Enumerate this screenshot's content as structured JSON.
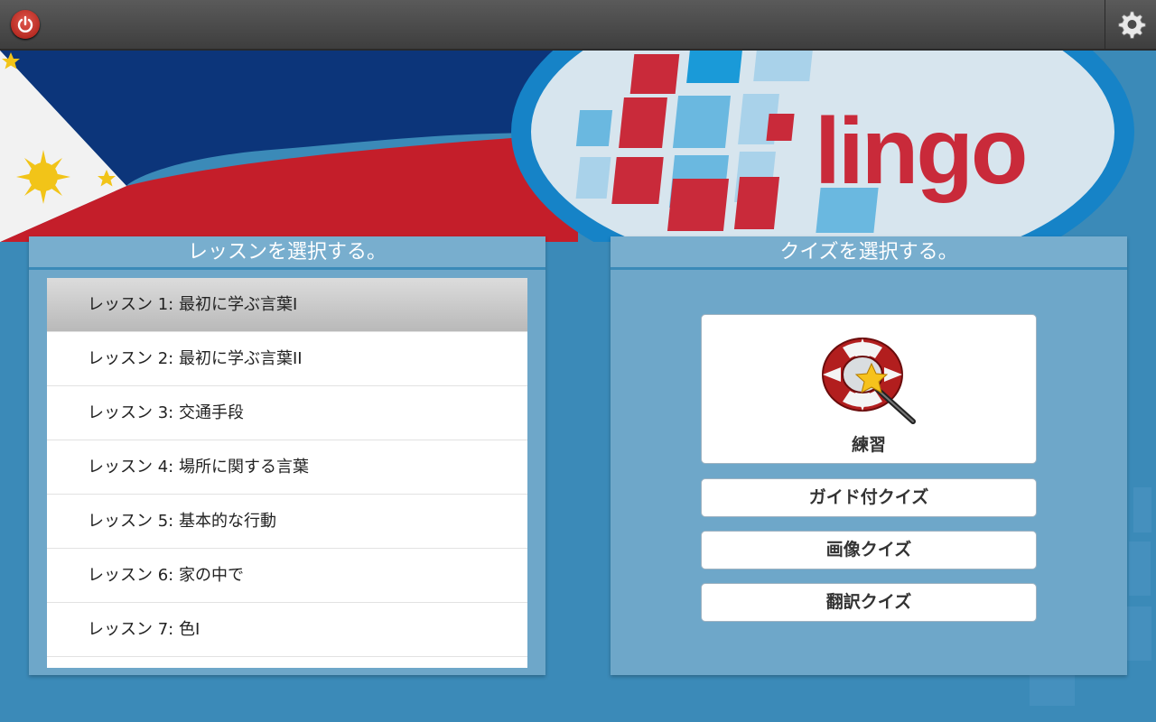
{
  "topbar": {
    "power_icon": "power-icon",
    "settings_icon": "gear-icon"
  },
  "banner": {
    "logo_text": "lingo"
  },
  "lessons_panel": {
    "title": "レッスンを選択する。",
    "items": [
      {
        "label": "レッスン 1: 最初に学ぶ言葉I"
      },
      {
        "label": "レッスン 2: 最初に学ぶ言葉II"
      },
      {
        "label": "レッスン 3: 交通手段"
      },
      {
        "label": "レッスン 4: 場所に関する言葉"
      },
      {
        "label": "レッスン 5: 基本的な行動"
      },
      {
        "label": "レッスン 6: 家の中で"
      },
      {
        "label": "レッスン 7: 色I"
      }
    ]
  },
  "quiz_panel": {
    "title": "クイズを選択する。",
    "practice_label": "練習",
    "guided_label": "ガイド付クイズ",
    "image_label": "画像クイズ",
    "translation_label": "翻訳クイズ"
  },
  "colors": {
    "accent": "#1683c7",
    "brand_red": "#c92a3a",
    "background": "#3b8ab8"
  }
}
